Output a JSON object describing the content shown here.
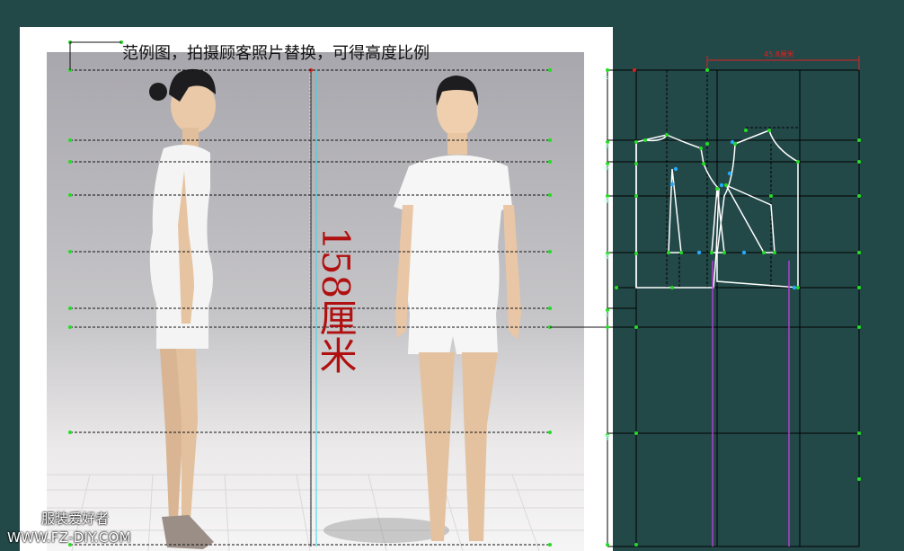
{
  "caption": "范例图，拍摄顾客照片替换，可得高度比例",
  "height_label": "158厘米",
  "watermark": {
    "name": "服装爱好者",
    "url": "WWW.FZ-DIY.COM"
  },
  "pattern_dimension_label": "45.8厘米",
  "colors": {
    "background": "#234848",
    "pattern_lines": "#ffffff",
    "guide_lines": "#000000",
    "grainline": "#b040d0",
    "point_green": "#22dd22",
    "point_cyan": "#22aaff",
    "dimension_red": "#e02020",
    "height_text": "#b01010"
  },
  "icons": [
    "measure-guide-line-icon",
    "pattern-point-icon"
  ]
}
